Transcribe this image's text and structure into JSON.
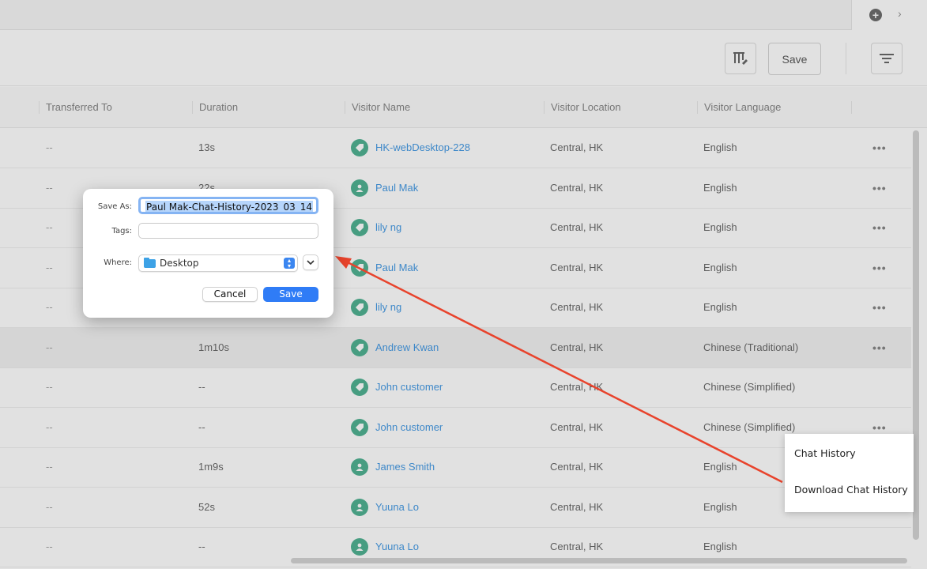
{
  "toolbar": {
    "save_label": "Save"
  },
  "columns": [
    "Transferred To",
    "Duration",
    "Visitor Name",
    "Visitor Location",
    "Visitor Language"
  ],
  "rows": [
    {
      "transferred": "--",
      "duration": "13s",
      "visitor": "HK-webDesktop-228",
      "avatar": "tag-icon",
      "location": "Central, HK",
      "language": "English",
      "more": "•••"
    },
    {
      "transferred": "--",
      "duration": "22s",
      "visitor": "Paul Mak",
      "avatar": "user-icon",
      "location": "Central, HK",
      "language": "English",
      "more": "•••"
    },
    {
      "transferred": "--",
      "duration": "",
      "visitor": "lily ng",
      "avatar": "tag-icon",
      "location": "Central, HK",
      "language": "English",
      "more": "•••"
    },
    {
      "transferred": "--",
      "duration": "",
      "visitor": "Paul Mak",
      "avatar": "tag-icon",
      "location": "Central, HK",
      "language": "English",
      "more": "•••"
    },
    {
      "transferred": "--",
      "duration": "",
      "visitor": "lily ng",
      "avatar": "tag-icon",
      "location": "Central, HK",
      "language": "English",
      "more": "•••"
    },
    {
      "transferred": "--",
      "duration": "1m10s",
      "visitor": "Andrew Kwan",
      "avatar": "tag-icon",
      "location": "Central, HK",
      "language": "Chinese (Traditional)",
      "more": "•••"
    },
    {
      "transferred": "--",
      "duration": "--",
      "visitor": "John customer",
      "avatar": "tag-icon",
      "location": "Central, HK",
      "language": "Chinese (Simplified)",
      "more": ""
    },
    {
      "transferred": "--",
      "duration": "--",
      "visitor": "John customer",
      "avatar": "tag-icon",
      "location": "Central, HK",
      "language": "Chinese (Simplified)",
      "more": "•••"
    },
    {
      "transferred": "--",
      "duration": "1m9s",
      "visitor": "James Smith",
      "avatar": "user-icon",
      "location": "Central, HK",
      "language": "English",
      "more": ""
    },
    {
      "transferred": "--",
      "duration": "52s",
      "visitor": "Yuuna Lo",
      "avatar": "user-icon",
      "location": "Central, HK",
      "language": "English",
      "more": ""
    },
    {
      "transferred": "--",
      "duration": "--",
      "visitor": "Yuuna Lo",
      "avatar": "user-icon",
      "location": "Central, HK",
      "language": "English",
      "more": ""
    }
  ],
  "context_menu": {
    "item1": "Chat History",
    "item2": "Download Chat History"
  },
  "dialog": {
    "save_as_label": "Save As:",
    "save_as_value": "Paul Mak-Chat-History-2023_03_14",
    "tags_label": "Tags:",
    "tags_value": "",
    "where_label": "Where:",
    "where_value": "Desktop",
    "cancel_label": "Cancel",
    "save_label": "Save"
  },
  "colors": {
    "accent": "#2f7cf6",
    "link": "#2f8ee0",
    "avatar": "#3aa884",
    "annotation_arrow": "#e8432c"
  }
}
